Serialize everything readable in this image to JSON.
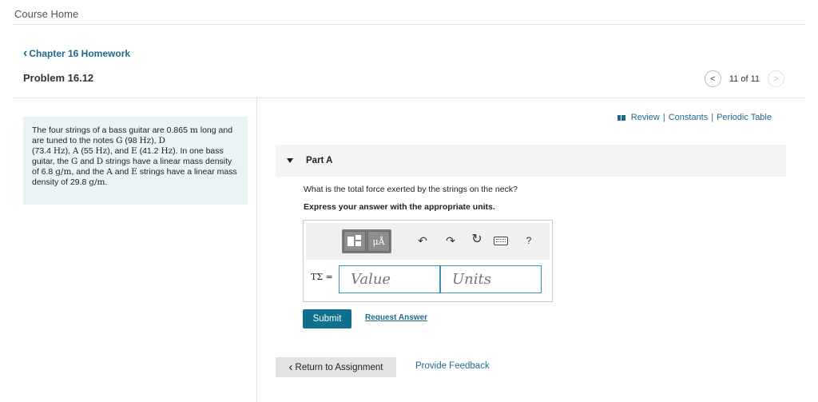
{
  "header": {
    "course_home": "Course Home"
  },
  "nav": {
    "chapter_link": "Chapter 16 Homework",
    "problem_title": "Problem 16.12",
    "pager_text": "11 of 11"
  },
  "problem": {
    "seg1": "The four strings of a bass guitar are 0.865 ",
    "u_m": "m",
    "seg2": " long and are tuned to the notes ",
    "note_g": "G",
    "seg3": " (98 ",
    "u_hz1": "Hz",
    "seg4": "), ",
    "note_d": "D",
    "seg5": " (73.4 ",
    "u_hz2": "Hz",
    "seg6": "), ",
    "note_a": "A",
    "seg7": " (55 ",
    "u_hz3": "Hz",
    "seg8": "), and ",
    "note_e": "E",
    "seg9": " (41.2 ",
    "u_hz4": "Hz",
    "seg10": "). In one bass guitar, the ",
    "note_g2": "G",
    "seg11": " and ",
    "note_d2": "D",
    "seg12": " strings have a linear mass density of 6.8 ",
    "u_gm1": "g/m",
    "seg13": ", and the ",
    "note_a2": "A",
    "seg14": " and ",
    "note_e2": "E",
    "seg15": " strings have a linear mass density of 29.8 ",
    "u_gm2": "g/m",
    "seg16": "."
  },
  "resources": {
    "review": "Review",
    "sep": "|",
    "constants": "Constants",
    "periodic_table": "Periodic Table"
  },
  "part": {
    "label": "Part A",
    "question": "What is the total force exerted by the strings on the neck?",
    "instructions": "Express your answer with the appropriate units."
  },
  "toolbar": {
    "mu_label": "μÅ",
    "undo": "↶",
    "redo": "↷",
    "reset": "↻",
    "help": "?"
  },
  "answer": {
    "variable_label": "TΣ =",
    "value_placeholder": "Value",
    "units_placeholder": "Units"
  },
  "actions": {
    "submit": "Submit",
    "request_answer": "Request Answer",
    "return_to_assignment": "Return to Assignment",
    "provide_feedback": "Provide Feedback"
  },
  "icons": {
    "chevron_left": "‹",
    "chevron_right": "›"
  },
  "colors": {
    "link": "#1d6a8c",
    "submit_bg": "#0f6f8f",
    "problem_bg": "#e9f5f5",
    "input_border": "#3a8fbf"
  }
}
